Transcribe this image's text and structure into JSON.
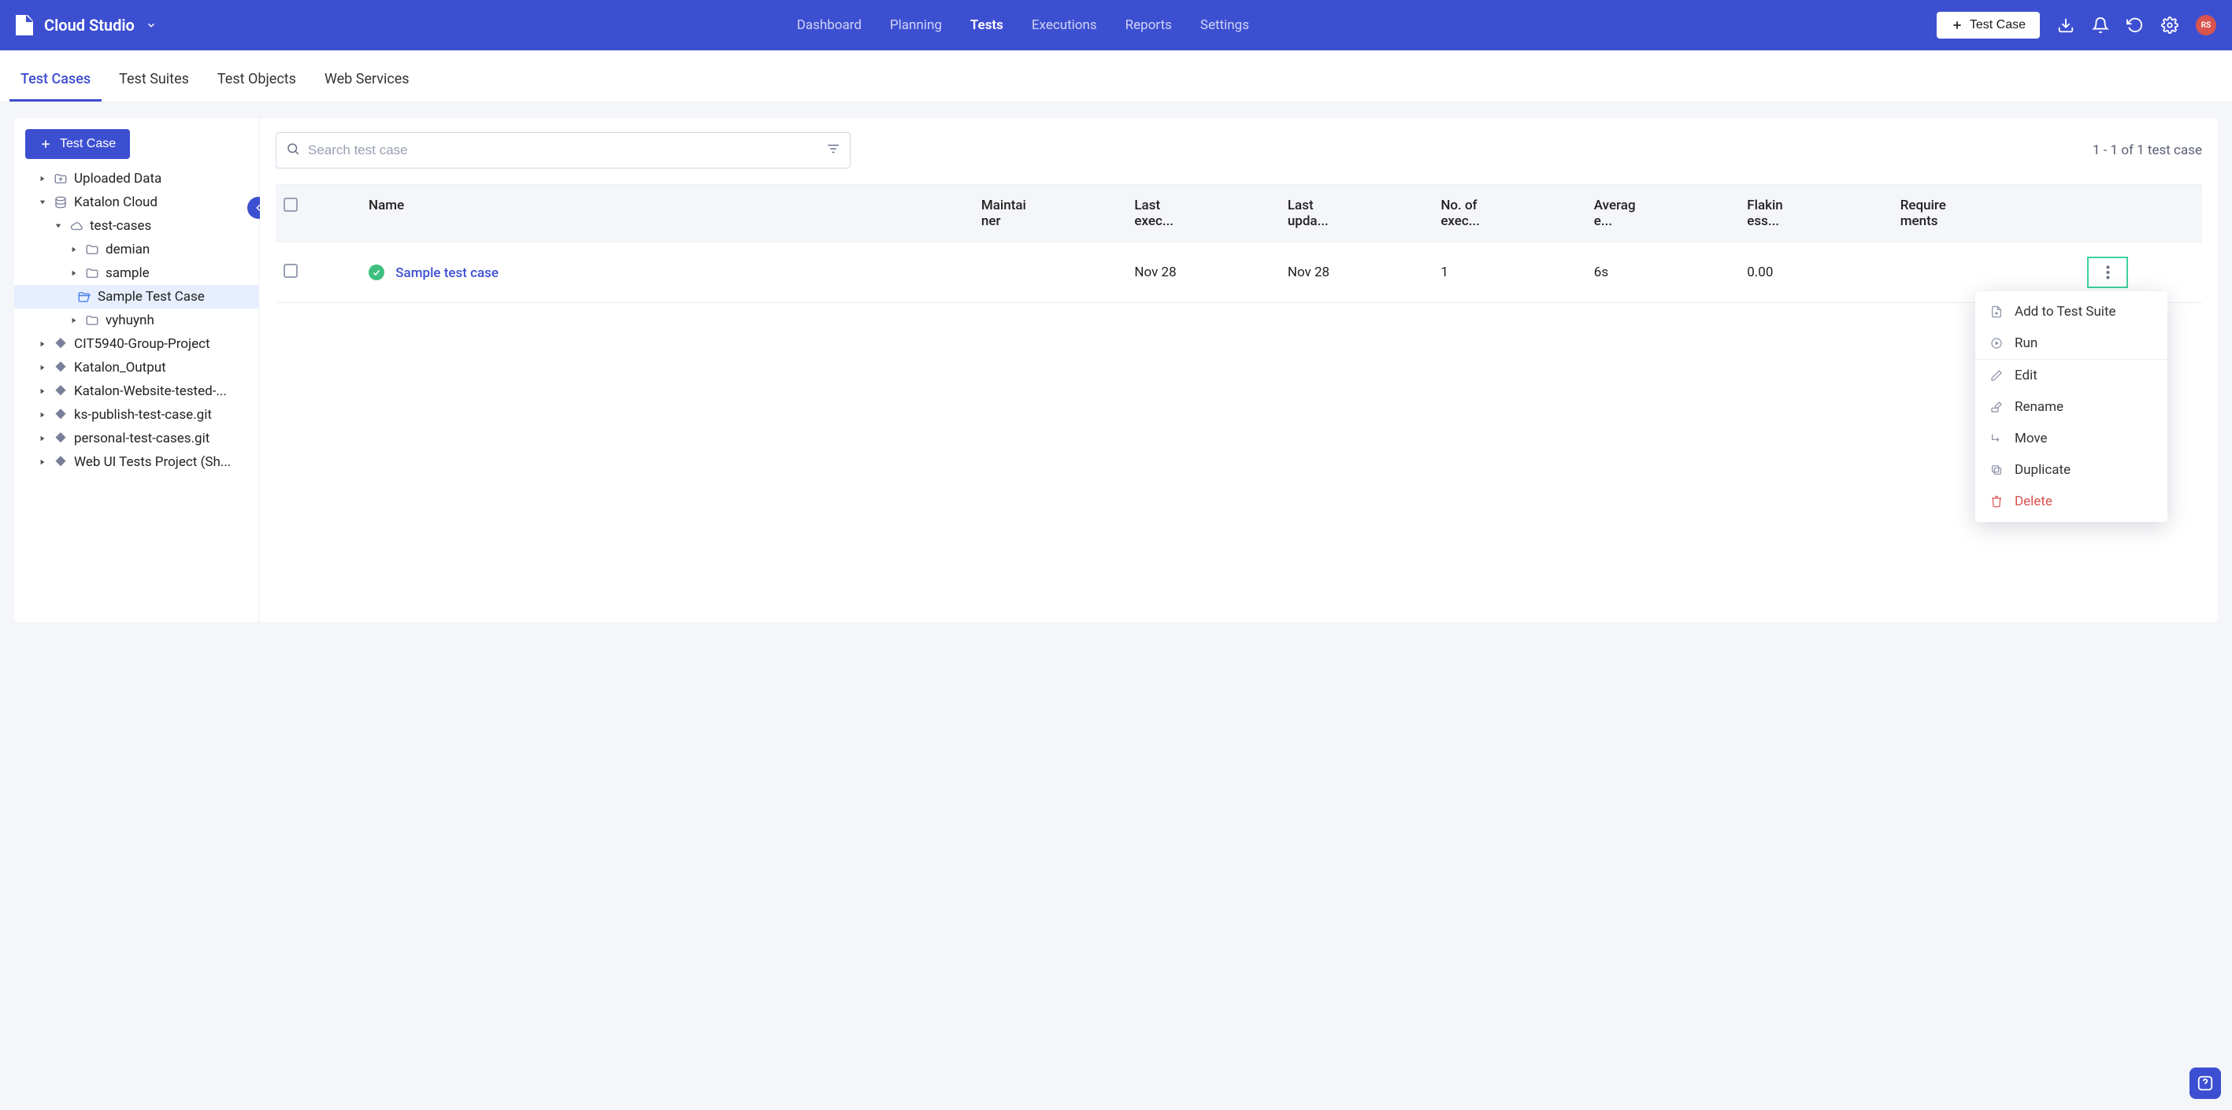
{
  "app": {
    "title": "Cloud Studio",
    "avatar": "RS"
  },
  "topnav": {
    "dashboard": "Dashboard",
    "planning": "Planning",
    "tests": "Tests",
    "executions": "Executions",
    "reports": "Reports",
    "settings": "Settings",
    "testcase_btn": "Test Case"
  },
  "subnav": {
    "test_cases": "Test Cases",
    "test_suites": "Test Suites",
    "test_objects": "Test Objects",
    "web_services": "Web Services"
  },
  "sidebar": {
    "add_btn": "Test Case",
    "tree": {
      "uploaded_data": "Uploaded Data",
      "katalon_cloud": "Katalon Cloud",
      "test_cases": "test-cases",
      "demian": "demian",
      "sample": "sample",
      "sample_test_case": "Sample Test Case",
      "vyhuynh": "vyhuynh",
      "cit5940": "CIT5940-Group-Project",
      "katalon_output": "Katalon_Output",
      "katalon_website": "Katalon-Website-tested-...",
      "ks_publish": "ks-publish-test-case.git",
      "personal": "personal-test-cases.git",
      "webui": "Web UI Tests Project (Sh..."
    }
  },
  "content": {
    "search_placeholder": "Search test case",
    "page_text": "1 - 1 of 1 test case",
    "columns": {
      "name": "Name",
      "maintainer": "Maintai\nner",
      "last_exec": "Last\nexec...",
      "last_upda": "Last\nupda...",
      "no_exec": "No. of\nexec...",
      "avg": "Averag\ne...",
      "flakiness": "Flakin\ness...",
      "requirements": "Require\nments"
    },
    "rows": [
      {
        "name": "Sample test case",
        "maintainer": "",
        "last_exec": "Nov 28",
        "last_upda": "Nov 28",
        "no_exec": "1",
        "avg": "6s",
        "flakiness": "0.00",
        "requirements": ""
      }
    ]
  },
  "ctxmenu": {
    "add_to_suite": "Add to Test Suite",
    "run": "Run",
    "edit": "Edit",
    "rename": "Rename",
    "move": "Move",
    "duplicate": "Duplicate",
    "delete": "Delete"
  }
}
